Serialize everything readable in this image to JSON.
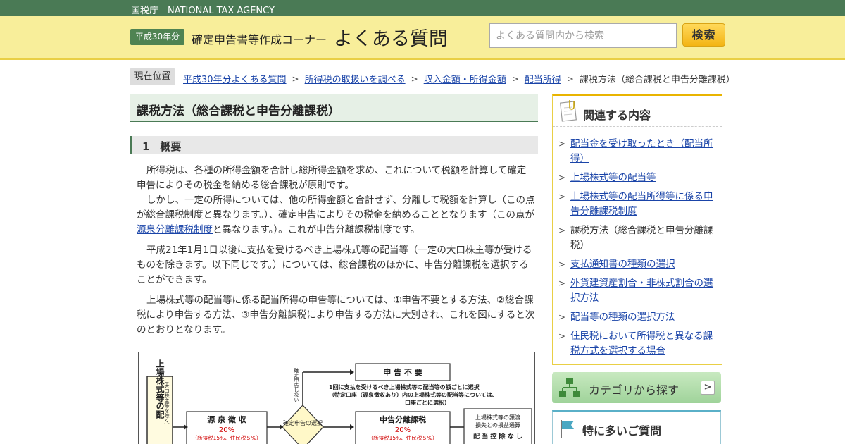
{
  "topbar": {
    "agency": "国税庁　NATIONAL TAX AGENCY"
  },
  "header": {
    "year_badge": "平成30年分",
    "corner_title": "確定申告書等作成コーナー",
    "faq_title": "よくある質問",
    "search_placeholder": "よくある質問内から検索",
    "search_button": "検索"
  },
  "breadcrumb": {
    "label": "現在位置",
    "items": [
      "平成30年分よくある質問",
      "所得税の取扱いを調べる",
      "収入金額・所得金額",
      "配当所得"
    ],
    "current": "課税方法（総合課税と申告分離課税）"
  },
  "main": {
    "title": "課税方法（総合課税と申告分離課税）",
    "section_title": "1　概要",
    "para1": "所得税は、各種の所得金額を合計し総所得金額を求め、これについて税額を計算して確定申告によりその税金を納める総合課税が原則です。",
    "para2_before": "しかし、一定の所得については、他の所得金額と合計せず、分離して税額を計算し（この点が総合課税制度と異なります。）、確定申告によりその税金を納めることとなります（この点が",
    "para2_link": "源泉分離課税制度",
    "para2_after": "と異なります。）。これが申告分離課税制度です。",
    "para3": "平成21年1月1日以後に支払を受けるべき上場株式等の配当等（一定の大口株主等が受けるものを除きます。以下同じです。）については、総合課税のほかに、申告分離課税を選択することができます。",
    "para4": "上場株式等の配当等に係る配当所得の申告等については、①申告不要とする方法、②総合課税により申告する方法、③申告分離課税により申告する方法に大別され、これを図にすると次のとおりとなります。"
  },
  "diagram": {
    "left_label": "上場株式等の配",
    "left_note": "（大口株主等を除く）",
    "withholding": "源 泉 徴 収",
    "withholding_rate": "20%",
    "withholding_detail": "（所得税15%、住民税５%）",
    "choice": "確定申告の選択",
    "no_declare": "確定申告しない",
    "not_required": "申 告 不 要",
    "note_line1": "1回に支払を受けるべき上場株式等の配当等の額ごとに選択",
    "note_line2": "（特定口座（源泉徴収あり）内の上場株式等の配当等については、",
    "note_line3": "口座ごとに選択）",
    "separate": "申告分離課税",
    "separate_rate": "20%",
    "separate_detail": "（所得税15%、住民税５%）",
    "offset_line1": "上場株式等の譲渡",
    "offset_line2": "損失との損益通算",
    "no_dividend_credit": "配 当 控 除 な し"
  },
  "sidebar": {
    "related_title": "関連する内容",
    "items": [
      {
        "label": "配当金を受け取ったとき（配当所得）",
        "link": true
      },
      {
        "label": "上場株式等の配当等",
        "link": true
      },
      {
        "label": "上場株式等の配当所得等に係る申告分離課税制度",
        "link": true
      },
      {
        "label": "課税方法（総合課税と申告分離課税）",
        "link": false
      },
      {
        "label": "支払通知書の種類の選択",
        "link": true
      },
      {
        "label": "外貨建資産割合・非株式割合の選択方法",
        "link": true
      },
      {
        "label": "配当等の種類の選択方法",
        "link": true
      },
      {
        "label": "住民税において所得税と異なる課税方式を選択する場合",
        "link": true
      }
    ],
    "category_button": "カテゴリから探す",
    "popular_title": "特に多いご質問"
  },
  "colors": {
    "topbar": "#4a7a55",
    "header_bg": "#f8ee9a",
    "link": "#1a44a8",
    "red_rate": "#d00000"
  }
}
